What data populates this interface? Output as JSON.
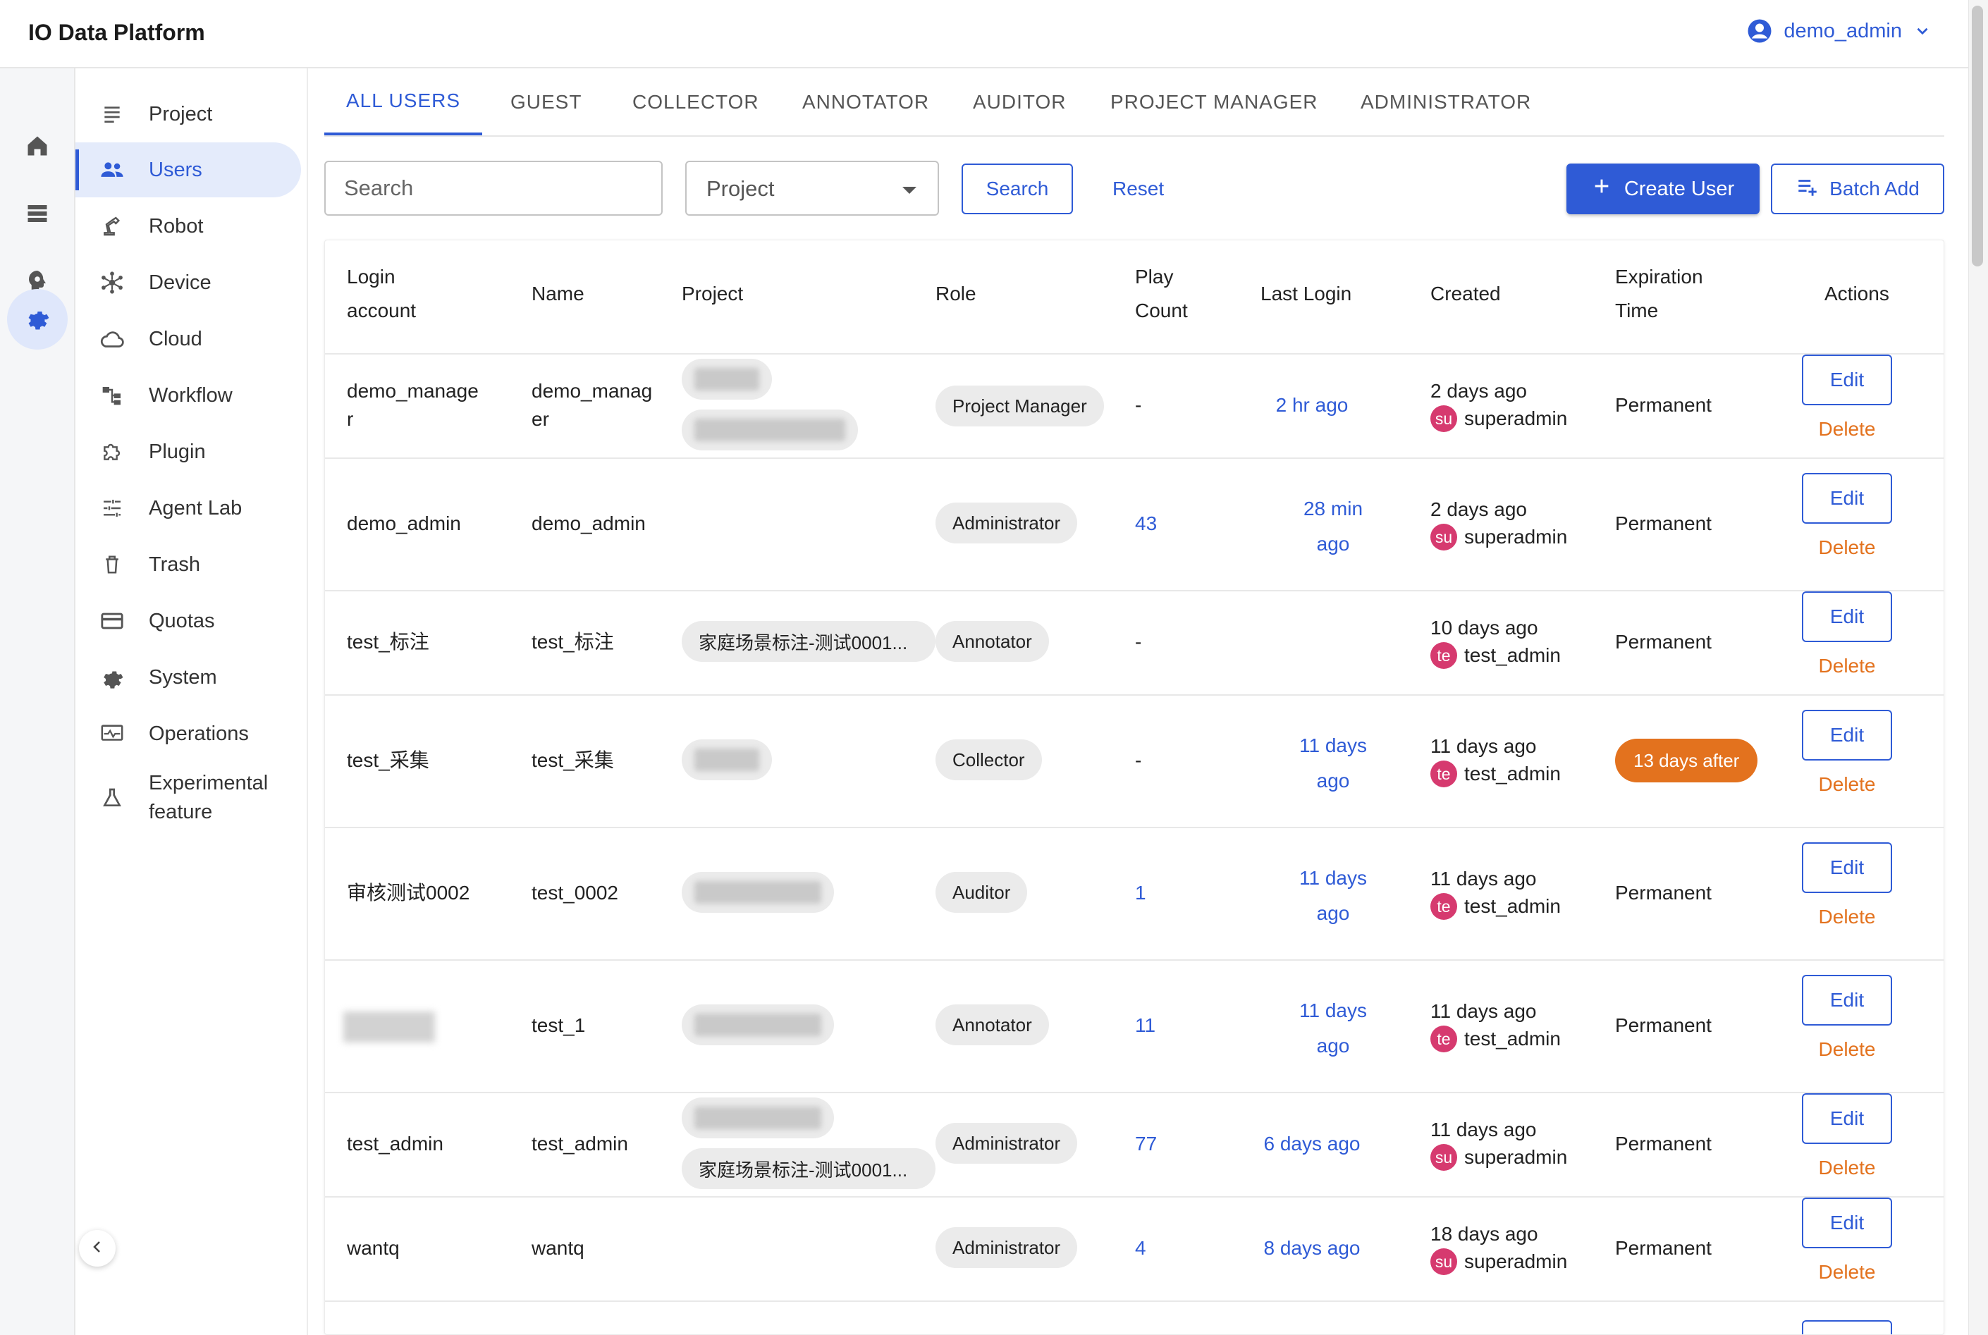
{
  "app_title": "IO Data Platform",
  "user_menu": {
    "username": "demo_admin",
    "icon": "account-circle-icon",
    "dropdown_icon": "chevron-down-icon"
  },
  "rail": [
    {
      "icon": "home-icon",
      "active": false
    },
    {
      "icon": "list-icon",
      "active": false
    },
    {
      "icon": "brain-icon",
      "active": false
    },
    {
      "icon": "gear-icon",
      "active": true
    }
  ],
  "nav": {
    "items": [
      {
        "label": "Project",
        "icon": "list-icon",
        "active": false
      },
      {
        "label": "Users",
        "icon": "users-icon",
        "active": true
      },
      {
        "label": "Robot",
        "icon": "robot-arm-icon",
        "active": false
      },
      {
        "label": "Device",
        "icon": "hub-icon",
        "active": false
      },
      {
        "label": "Cloud",
        "icon": "cloud-icon",
        "active": false
      },
      {
        "label": "Workflow",
        "icon": "workflow-icon",
        "active": false
      },
      {
        "label": "Plugin",
        "icon": "puzzle-icon",
        "active": false
      },
      {
        "label": "Agent Lab",
        "icon": "sliders-icon",
        "active": false
      },
      {
        "label": "Trash",
        "icon": "trash-icon",
        "active": false
      },
      {
        "label": "Quotas",
        "icon": "card-icon",
        "active": false
      },
      {
        "label": "System",
        "icon": "gear-icon",
        "active": false
      },
      {
        "label": "Operations",
        "icon": "monitor-icon",
        "active": false
      },
      {
        "label": "Experimental feature",
        "icon": "flask-icon",
        "active": false
      }
    ],
    "collapse_icon": "chevron-left-icon"
  },
  "tabs": [
    {
      "label": "ALL USERS",
      "active": true
    },
    {
      "label": "GUEST",
      "active": false
    },
    {
      "label": "COLLECTOR",
      "active": false
    },
    {
      "label": "ANNOTATOR",
      "active": false
    },
    {
      "label": "AUDITOR",
      "active": false
    },
    {
      "label": "PROJECT MANAGER",
      "active": false
    },
    {
      "label": "ADMINISTRATOR",
      "active": false
    }
  ],
  "filters": {
    "search_placeholder": "Search",
    "project_select": "Project",
    "search_button": "Search",
    "reset_button": "Reset",
    "create_button": "Create User",
    "batch_button": "Batch Add"
  },
  "table": {
    "headers": {
      "login": "Login account",
      "name": "Name",
      "project": "Project",
      "role": "Role",
      "play_count": "Play Count",
      "last_login": "Last Login",
      "created": "Created",
      "expiration": "Expiration Time",
      "actions": "Actions"
    },
    "edit_label": "Edit",
    "delete_label": "Delete",
    "rows": [
      {
        "login": "demo_manage r",
        "name": "demo_manag er",
        "projects": [
          "",
          ""
        ],
        "role": "Project Manager",
        "play_count": "-",
        "last_login": "2 hr ago",
        "created": "2 days ago",
        "creator_initials": "su",
        "creator": "superadmin",
        "expiration": "Permanent"
      },
      {
        "login": "demo_admin",
        "name": "demo_admin",
        "projects": [],
        "role": "Administrator",
        "play_count": "43",
        "last_login": "28 min ago",
        "created": "2 days ago",
        "creator_initials": "su",
        "creator": "superadmin",
        "expiration": "Permanent"
      },
      {
        "login": "test_标注",
        "name": "test_标注",
        "projects": [
          "家庭场景标注-测试0001..."
        ],
        "role": "Annotator",
        "play_count": "-",
        "last_login": "",
        "created": "10 days ago",
        "creator_initials": "te",
        "creator": "test_admin",
        "expiration": "Permanent"
      },
      {
        "login": "test_采集",
        "name": "test_采集",
        "projects": [
          ""
        ],
        "role": "Collector",
        "play_count": "-",
        "last_login": "11 days ago",
        "created": "11 days ago",
        "creator_initials": "te",
        "creator": "test_admin",
        "expiration": "13 days after"
      },
      {
        "login": "审核测试0002",
        "name": "test_0002",
        "projects": [
          ""
        ],
        "role": "Auditor",
        "play_count": "1",
        "last_login": "11 days ago",
        "created": "11 days ago",
        "creator_initials": "te",
        "creator": "test_admin",
        "expiration": "Permanent"
      },
      {
        "login": "",
        "name": "test_1",
        "projects": [
          ""
        ],
        "role": "Annotator",
        "play_count": "11",
        "last_login": "11 days ago",
        "created": "11 days ago",
        "creator_initials": "te",
        "creator": "test_admin",
        "expiration": "Permanent"
      },
      {
        "login": "test_admin",
        "name": "test_admin",
        "projects": [
          "",
          "家庭场景标注-测试0001..."
        ],
        "role": "Administrator",
        "play_count": "77",
        "last_login": "6 days ago",
        "created": "11 days ago",
        "creator_initials": "su",
        "creator": "superadmin",
        "expiration": "Permanent"
      },
      {
        "login": "wantq",
        "name": "wantq",
        "projects": [],
        "role": "Administrator",
        "play_count": "4",
        "last_login": "8 days ago",
        "created": "18 days ago",
        "creator_initials": "su",
        "creator": "superadmin",
        "expiration": "Permanent"
      }
    ]
  },
  "colors": {
    "primary": "#2f5bd6",
    "danger_orange": "#e3721e",
    "avatar_pink": "#d63a6f",
    "chip_gray": "#ebebeb"
  }
}
